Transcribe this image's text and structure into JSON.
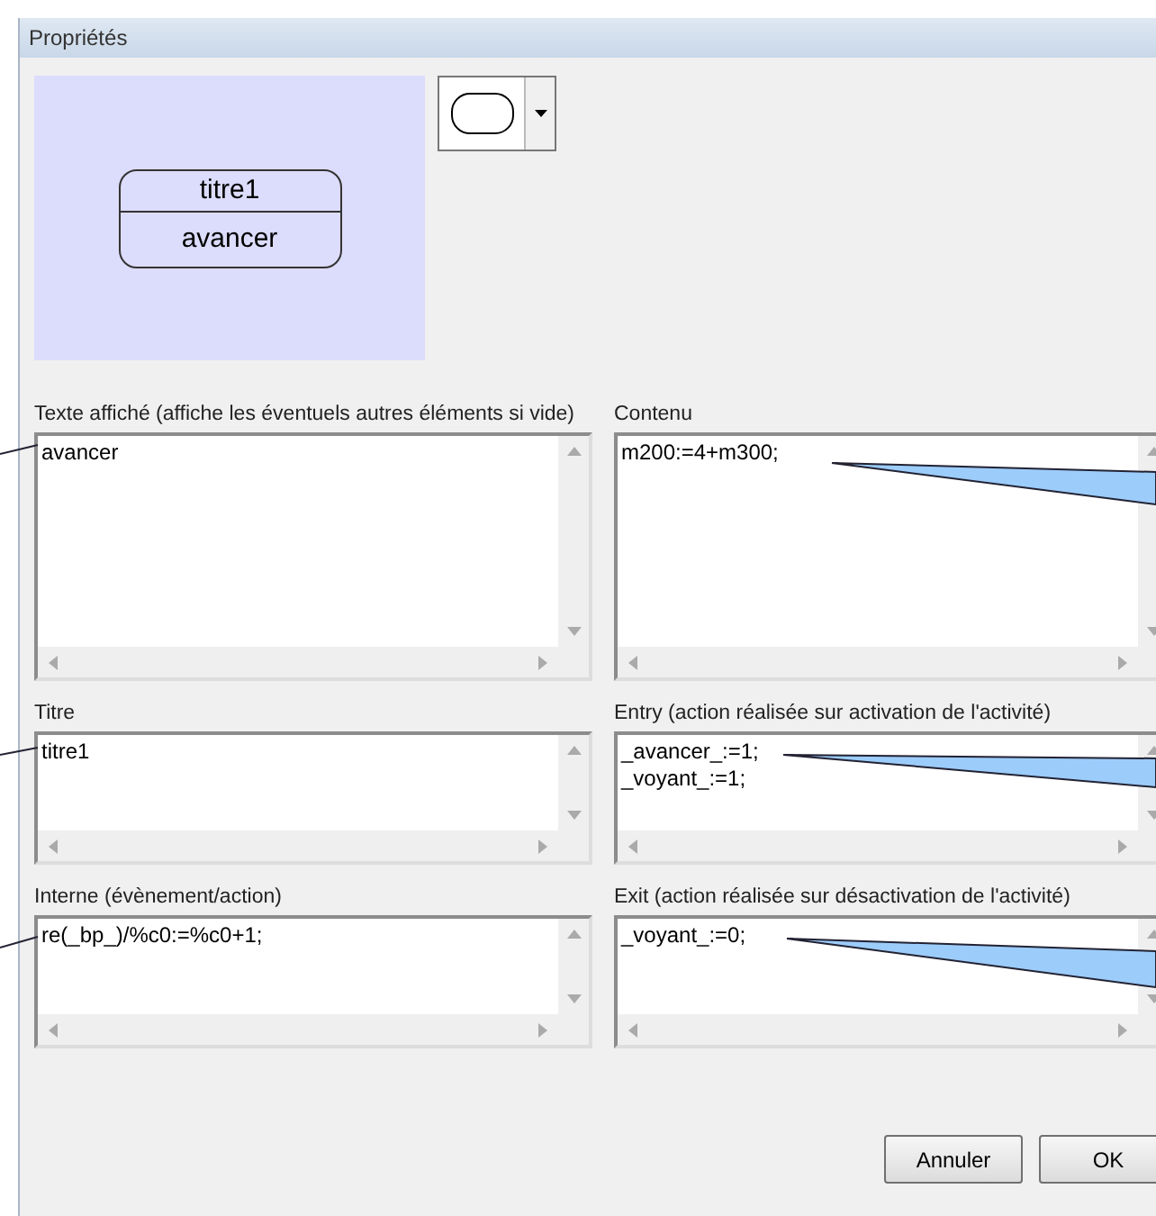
{
  "window": {
    "title": "Propriétés"
  },
  "preview": {
    "title": "titre1",
    "text": "avancer"
  },
  "fields": [
    {
      "label": "Texte affiché (affiche les éventuels autres éléments si vide)",
      "lines": [
        "avancer"
      ]
    },
    {
      "label": "Contenu",
      "lines": [
        "m200:=4+m300;"
      ]
    },
    {
      "label": "Titre",
      "lines": [
        "titre1"
      ]
    },
    {
      "label": "Entry (action réalisée sur activation de l'activité)",
      "lines": [
        "_avancer_:=1;",
        "_voyant_:=1;"
      ]
    },
    {
      "label": "Interne (évènement/action)",
      "lines": [
        "re(_bp_)/%c0:=%c0+1;"
      ]
    },
    {
      "label": "Exit (action réalisée sur désactivation de l'activité)",
      "lines": [
        "_voyant_:=0;"
      ]
    }
  ],
  "buttons": [
    "Annuler",
    "OK"
  ]
}
